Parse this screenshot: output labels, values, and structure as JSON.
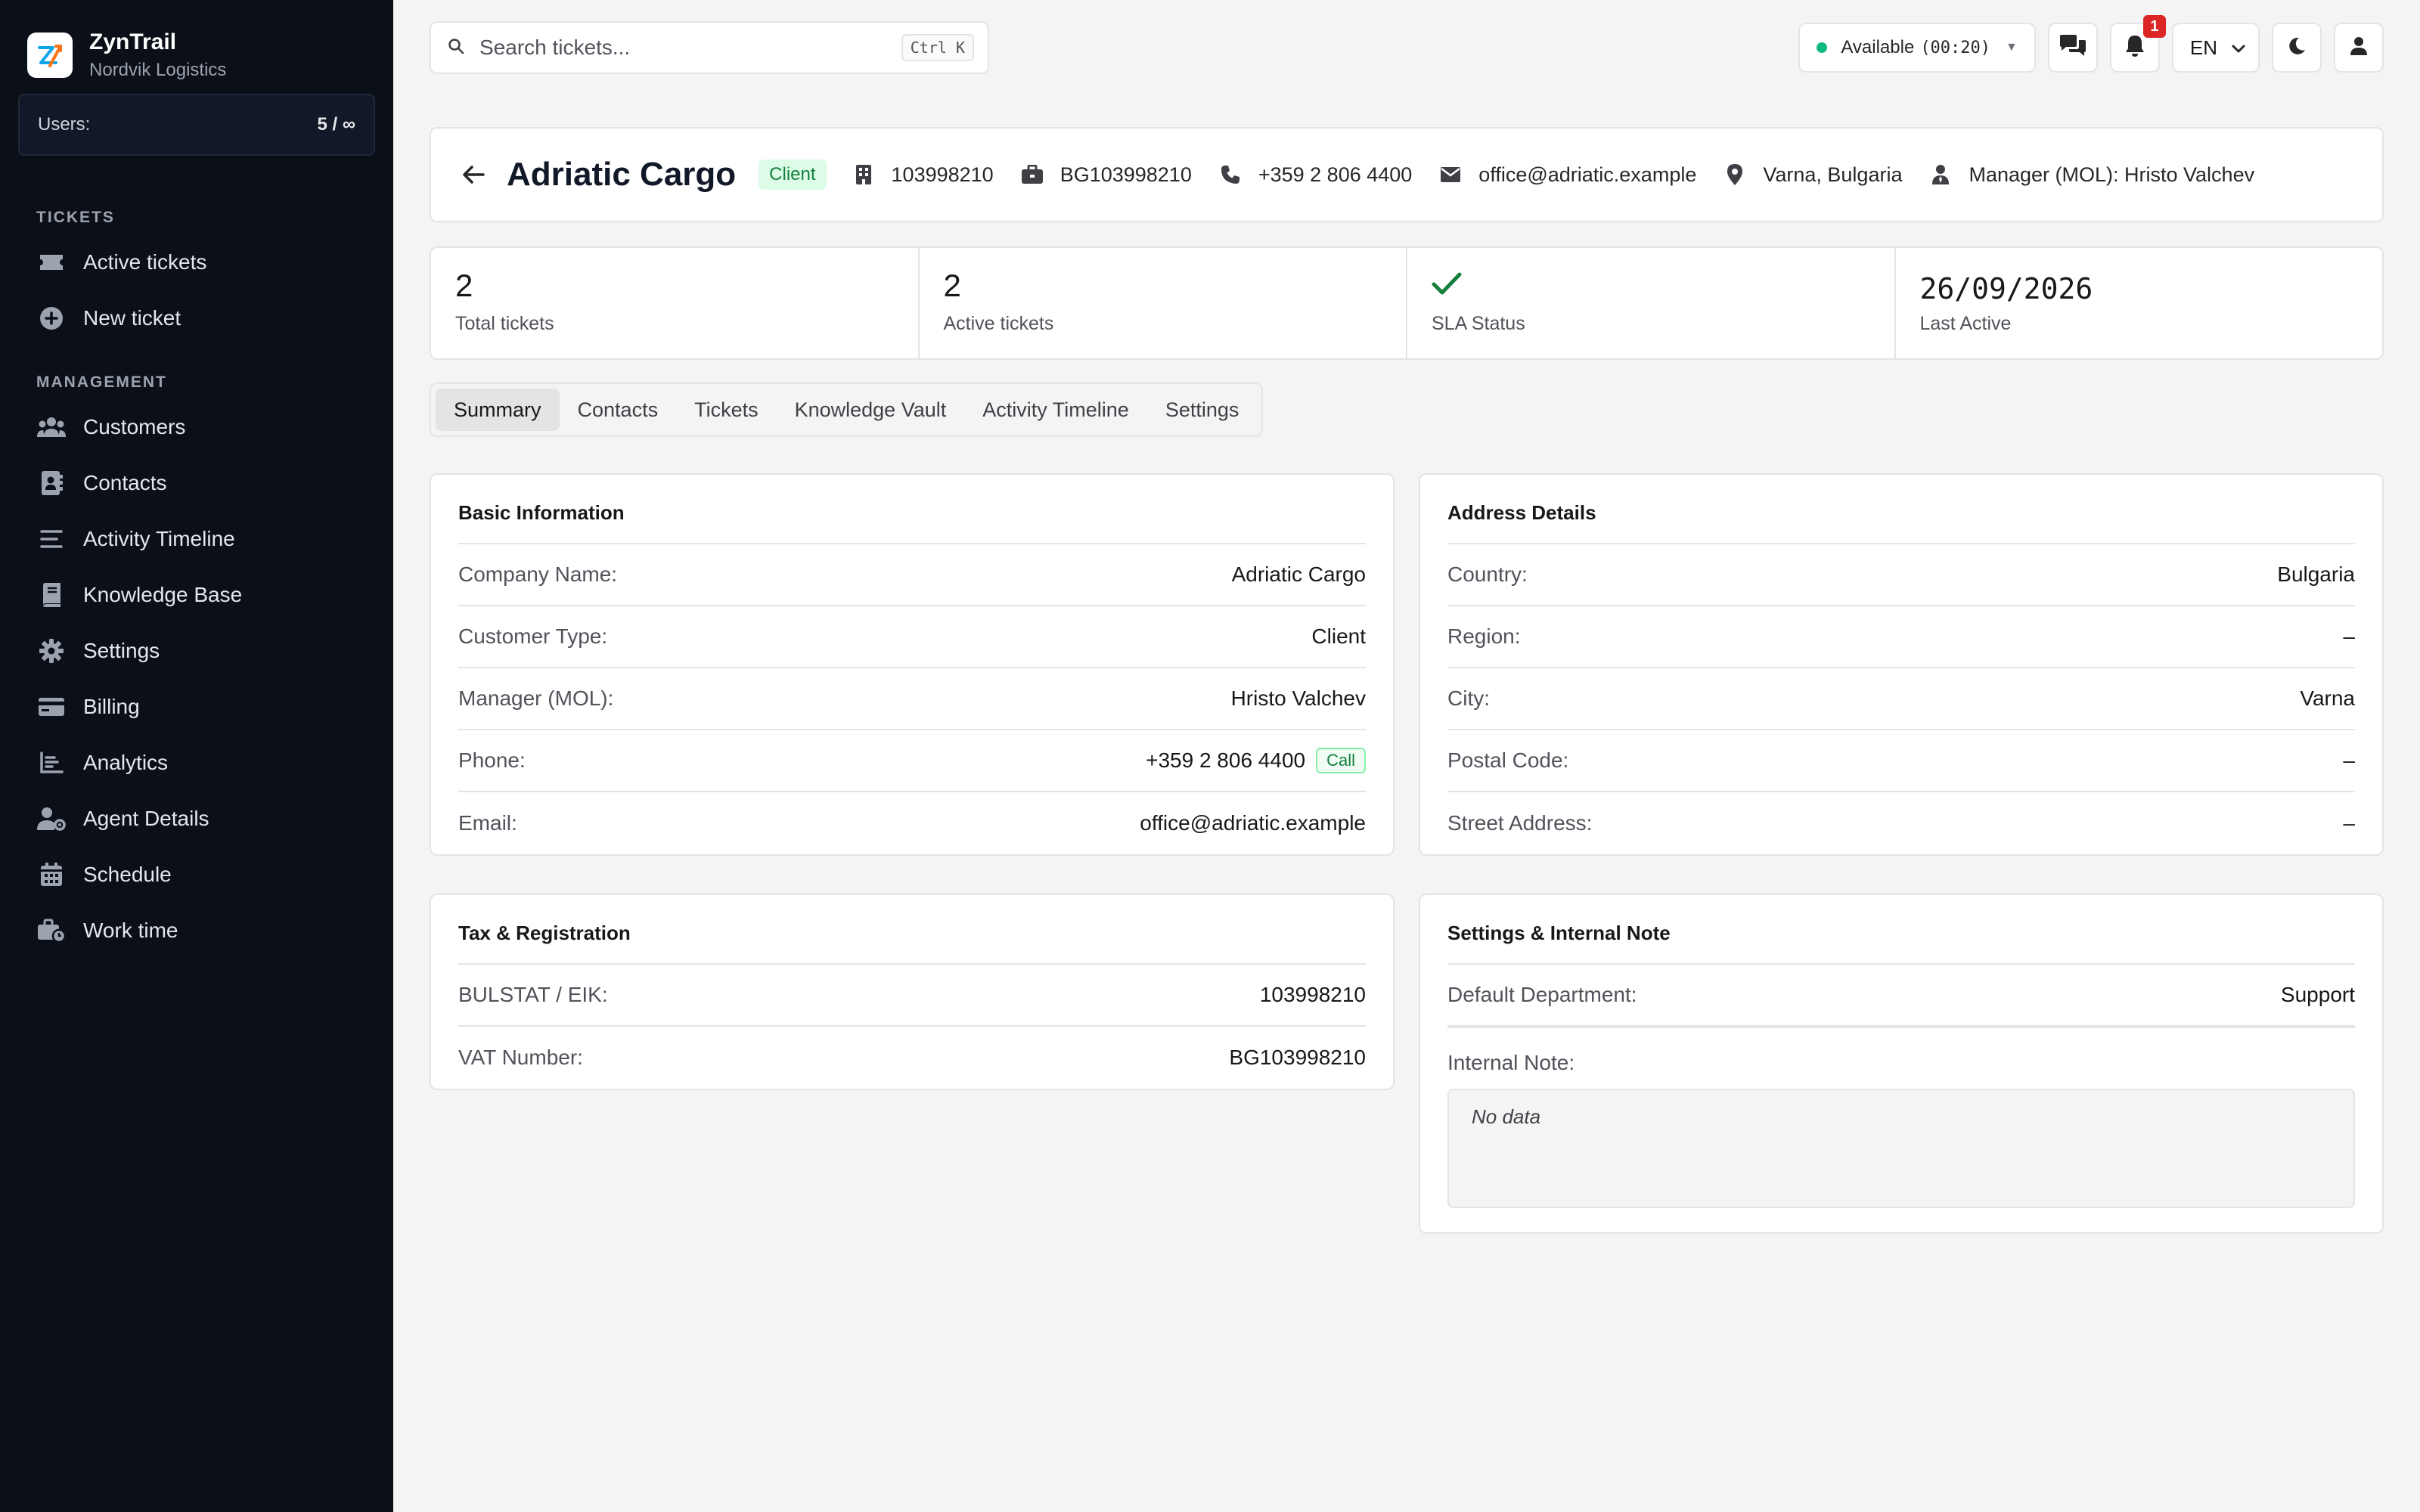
{
  "brand": {
    "name": "ZynTrail",
    "org": "Nordvik Logistics"
  },
  "users": {
    "label": "Users:",
    "value": "5 / ∞"
  },
  "sidebar": {
    "tickets_heading": "TICKETS",
    "tickets": [
      {
        "label": "Active tickets",
        "icon": "ticket-icon"
      },
      {
        "label": "New ticket",
        "icon": "plus-circle-icon"
      }
    ],
    "management_heading": "MANAGEMENT",
    "management": [
      {
        "label": "Customers",
        "icon": "users-icon"
      },
      {
        "label": "Contacts",
        "icon": "address-book-icon"
      },
      {
        "label": "Activity Timeline",
        "icon": "list-icon"
      },
      {
        "label": "Knowledge Base",
        "icon": "book-icon"
      },
      {
        "label": "Settings",
        "icon": "gear-icon"
      },
      {
        "label": "Billing",
        "icon": "credit-card-icon"
      },
      {
        "label": "Analytics",
        "icon": "chart-icon"
      },
      {
        "label": "Agent Details",
        "icon": "user-cog-icon"
      },
      {
        "label": "Schedule",
        "icon": "calendar-icon"
      },
      {
        "label": "Work time",
        "icon": "briefcase-clock-icon"
      }
    ]
  },
  "topbar": {
    "search_placeholder": "Search tickets...",
    "search_shortcut": "Ctrl K",
    "status_label": "Available",
    "status_timer": "(00:20)",
    "notifications_count": "1",
    "language": "EN",
    "status_color": "#10b981"
  },
  "customer": {
    "name": "Adriatic Cargo",
    "type_tag": "Client",
    "eik": "103998210",
    "vat": "BG103998210",
    "phone": "+359 2 806 4400",
    "email": "office@adriatic.example",
    "location": "Varna, Bulgaria",
    "manager": "Manager (MOL): Hristo Valchev"
  },
  "stats": {
    "total_tickets": {
      "value": "2",
      "label": "Total tickets"
    },
    "active_tickets": {
      "value": "2",
      "label": "Active tickets"
    },
    "sla": {
      "label": "SLA Status",
      "icon": "check-icon"
    },
    "last_active": {
      "value": "26/09/2026",
      "label": "Last Active"
    }
  },
  "tabs": [
    "Summary",
    "Contacts",
    "Tickets",
    "Knowledge Vault",
    "Activity Timeline",
    "Settings"
  ],
  "basic_info": {
    "title": "Basic Information",
    "rows": [
      {
        "k": "Company Name:",
        "v": "Adriatic Cargo"
      },
      {
        "k": "Customer Type:",
        "v": "Client"
      },
      {
        "k": "Manager (MOL):",
        "v": "Hristo Valchev"
      },
      {
        "k": "Phone:",
        "v": "+359 2 806 4400",
        "action": "Call"
      },
      {
        "k": "Email:",
        "v": "office@adriatic.example"
      }
    ]
  },
  "address": {
    "title": "Address Details",
    "rows": [
      {
        "k": "Country:",
        "v": "Bulgaria"
      },
      {
        "k": "Region:",
        "v": "–"
      },
      {
        "k": "City:",
        "v": "Varna"
      },
      {
        "k": "Postal Code:",
        "v": "–"
      },
      {
        "k": "Street Address:",
        "v": "–"
      }
    ]
  },
  "tax": {
    "title": "Tax & Registration",
    "rows": [
      {
        "k": "BULSTAT / EIK:",
        "v": "103998210"
      },
      {
        "k": "VAT Number:",
        "v": "BG103998210"
      }
    ]
  },
  "settings_note": {
    "title": "Settings & Internal Note",
    "rows": [
      {
        "k": "Default Department:",
        "v": "Support"
      }
    ],
    "note_label": "Internal Note:",
    "note_value": "No data"
  }
}
